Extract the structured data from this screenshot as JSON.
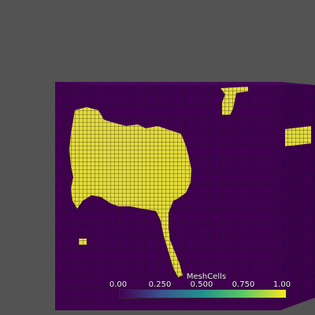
{
  "window": {
    "background": "#535353"
  },
  "scene": {
    "mesh_base_color": "#440154",
    "highlight_color": "#fde725",
    "grid_line_color": "#1a0022",
    "description_icon": "mesh-volume"
  },
  "legend": {
    "title": "MeshCells",
    "ticks": [
      "0.00",
      "0.250",
      "0.500",
      "0.750",
      "1.00"
    ],
    "colormap": "viridis",
    "colors": [
      "#440154",
      "#3b528b",
      "#21918c",
      "#5ec962",
      "#fde725"
    ]
  }
}
